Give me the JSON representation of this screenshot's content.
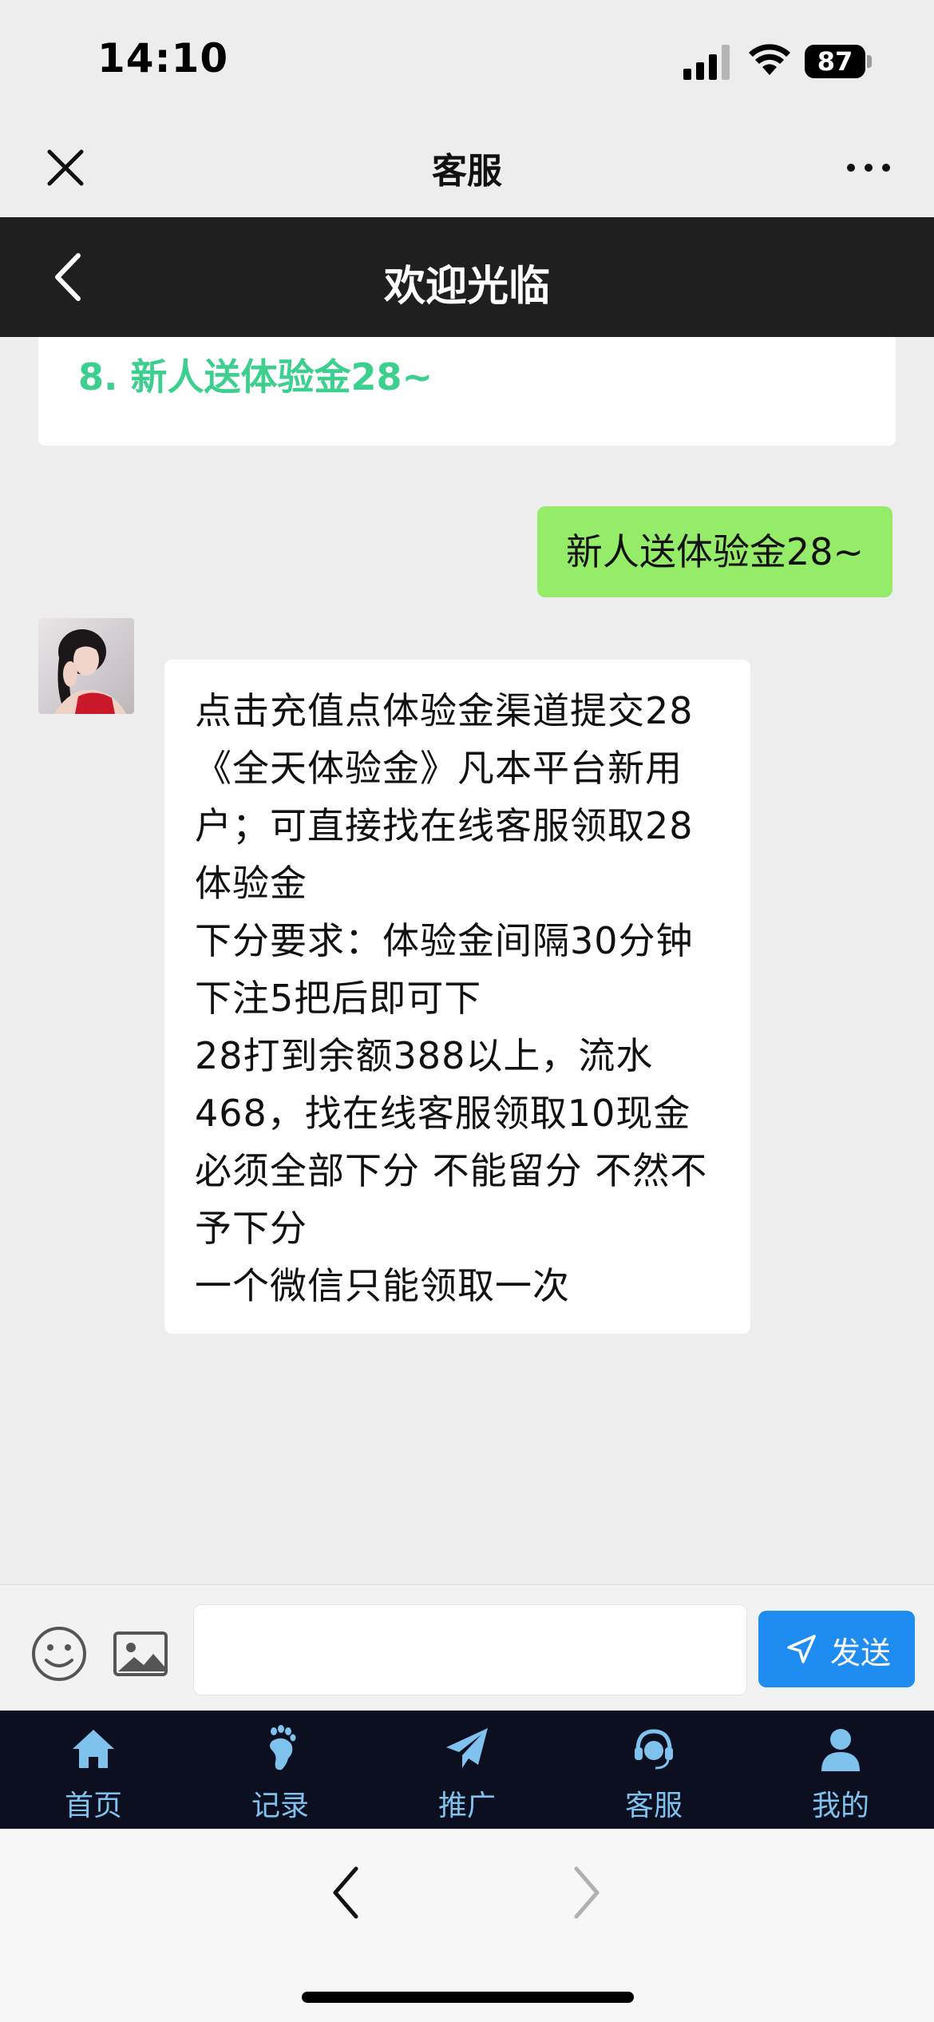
{
  "status_bar": {
    "time": "14:10",
    "battery": "87"
  },
  "top_nav": {
    "title": "客服"
  },
  "header": {
    "title": "欢迎光临"
  },
  "chat": {
    "previous_card_text": "8. 新人送体验金28~",
    "outgoing_message": "新人送体验金28~",
    "incoming_message_lines": [
      "点击充值点体验金渠道提交28",
      "《全天体验金》凡本平台新用",
      "户；可直接找在线客服领取28",
      "体验金",
      "下分要求：体验金间隔30分钟",
      "下注5把后即可下",
      "28打到余额388以上，流水",
      "468，找在线客服领取10现金",
      "必须全部下分 不能留分 不然不",
      "予下分",
      "一个微信只能领取一次"
    ]
  },
  "input_bar": {
    "placeholder": "",
    "send_label": "发送"
  },
  "tabs": [
    {
      "label": "首页",
      "icon": "home-icon"
    },
    {
      "label": "记录",
      "icon": "footprint-icon"
    },
    {
      "label": "推广",
      "icon": "paper-plane-icon"
    },
    {
      "label": "客服",
      "icon": "headset-icon"
    },
    {
      "label": "我的",
      "icon": "user-icon"
    }
  ]
}
